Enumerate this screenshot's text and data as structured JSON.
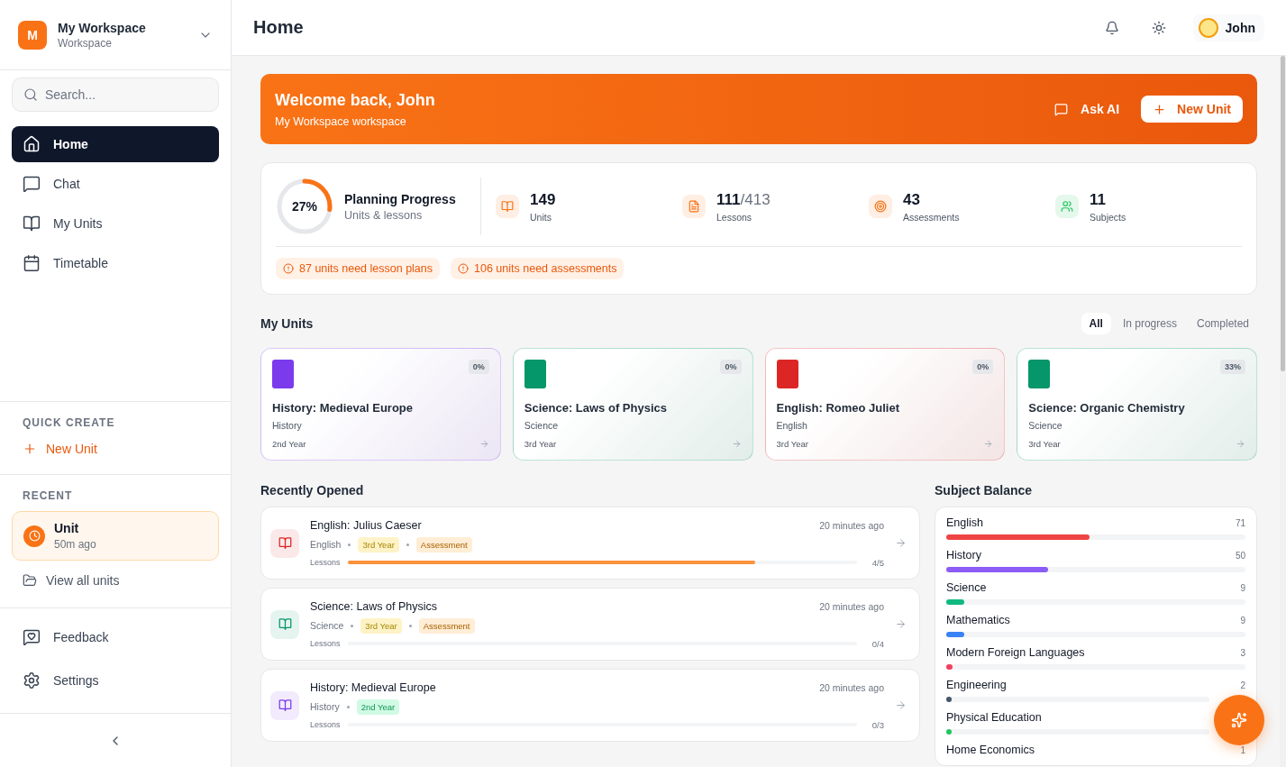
{
  "workspace": {
    "initial": "M",
    "name": "My Workspace",
    "subtitle": "Workspace"
  },
  "search": {
    "placeholder": "Search..."
  },
  "nav": [
    {
      "label": "Home",
      "selected": true
    },
    {
      "label": "Chat",
      "selected": false
    },
    {
      "label": "My Units",
      "selected": false
    },
    {
      "label": "Timetable",
      "selected": false
    }
  ],
  "quick_create": {
    "heading": "QUICK CREATE",
    "action": "New Unit"
  },
  "recent": {
    "heading": "RECENT",
    "item": {
      "title": "Unit",
      "time": "50m ago"
    },
    "view_all": "View all units"
  },
  "footer_nav": [
    "Feedback",
    "Settings"
  ],
  "header": {
    "title": "Home",
    "user": "John"
  },
  "banner": {
    "title": "Welcome back, John",
    "subtitle": "My Workspace workspace",
    "ask": "Ask AI",
    "new": "New Unit"
  },
  "progress": {
    "percent": "27%",
    "level": 0.27,
    "title": "Planning Progress",
    "subtitle": "Units & lessons"
  },
  "stats": [
    {
      "value": "149",
      "label": "Units",
      "color": "#f97316"
    },
    {
      "value": "111",
      "suffix": "/413",
      "label": "Lessons",
      "color": "#f97316"
    },
    {
      "value": "43",
      "label": "Assessments",
      "color": "#f97316"
    },
    {
      "value": "11",
      "label": "Subjects",
      "color": "#22c55e"
    }
  ],
  "alerts": [
    "87 units need lesson plans",
    "106 units need assessments"
  ],
  "my_units": {
    "title": "My Units",
    "filters": [
      {
        "label": "All",
        "selected": true
      },
      {
        "label": "In progress",
        "selected": false
      },
      {
        "label": "Completed",
        "selected": false
      }
    ],
    "cards": [
      {
        "title": "History: Medieval Europe",
        "subject": "History",
        "year": "2nd Year",
        "percent": "0%",
        "color": "#7c3aed"
      },
      {
        "title": "Science: Laws of Physics",
        "subject": "Science",
        "year": "3rd Year",
        "percent": "0%",
        "color": "#059669"
      },
      {
        "title": "English: Romeo Juliet",
        "subject": "English",
        "year": "3rd Year",
        "percent": "0%",
        "color": "#dc2626"
      },
      {
        "title": "Science: Organic Chemistry",
        "subject": "Science",
        "year": "3rd Year",
        "percent": "33%",
        "color": "#059669"
      }
    ]
  },
  "recently_opened": {
    "title": "Recently Opened",
    "items": [
      {
        "title": "English: Julius Caeser",
        "subject": "English",
        "time": "20 minutes ago",
        "color": "#dc2626",
        "tags": [
          {
            "label": "3rd Year",
            "color": "#fef3c7"
          },
          {
            "label": "Assessment",
            "color": "#ffedd5"
          }
        ],
        "lessons_label": "Lessons",
        "count": "4/5",
        "level": 0.8
      },
      {
        "title": "Science: Laws of Physics",
        "subject": "Science",
        "time": "20 minutes ago",
        "color": "#059669",
        "tags": [
          {
            "label": "3rd Year",
            "color": "#fef3c7"
          },
          {
            "label": "Assessment",
            "color": "#ffedd5"
          }
        ],
        "lessons_label": "Lessons",
        "count": "0/4"
      },
      {
        "title": "History: Medieval Europe",
        "subject": "History",
        "time": "20 minutes ago",
        "color": "#7c3aed",
        "tags": [
          {
            "label": "2nd Year",
            "color": "#d1fae5"
          }
        ],
        "lessons_label": "Lessons",
        "count": "0/3"
      }
    ]
  },
  "subject_balance": {
    "title": "Subject Balance",
    "items": [
      {
        "name": "English",
        "count": "71",
        "level": 0.48,
        "color": "#ef4444"
      },
      {
        "name": "History",
        "count": "50",
        "level": 0.34,
        "color": "#8b5cf6"
      },
      {
        "name": "Science",
        "count": "9",
        "level": 0.06,
        "color": "#10b981"
      },
      {
        "name": "Mathematics",
        "count": "9",
        "level": 0.06,
        "color": "#3b82f6"
      },
      {
        "name": "Modern Foreign Languages",
        "count": "3",
        "level": 0.02,
        "color": "#f43f5e"
      },
      {
        "name": "Engineering",
        "count": "2",
        "level": 0.01,
        "color": "#475569"
      },
      {
        "name": "Physical Education",
        "level": 0.01,
        "color": "#22c55e"
      },
      {
        "name": "Home Economics",
        "count": "1"
      }
    ]
  }
}
